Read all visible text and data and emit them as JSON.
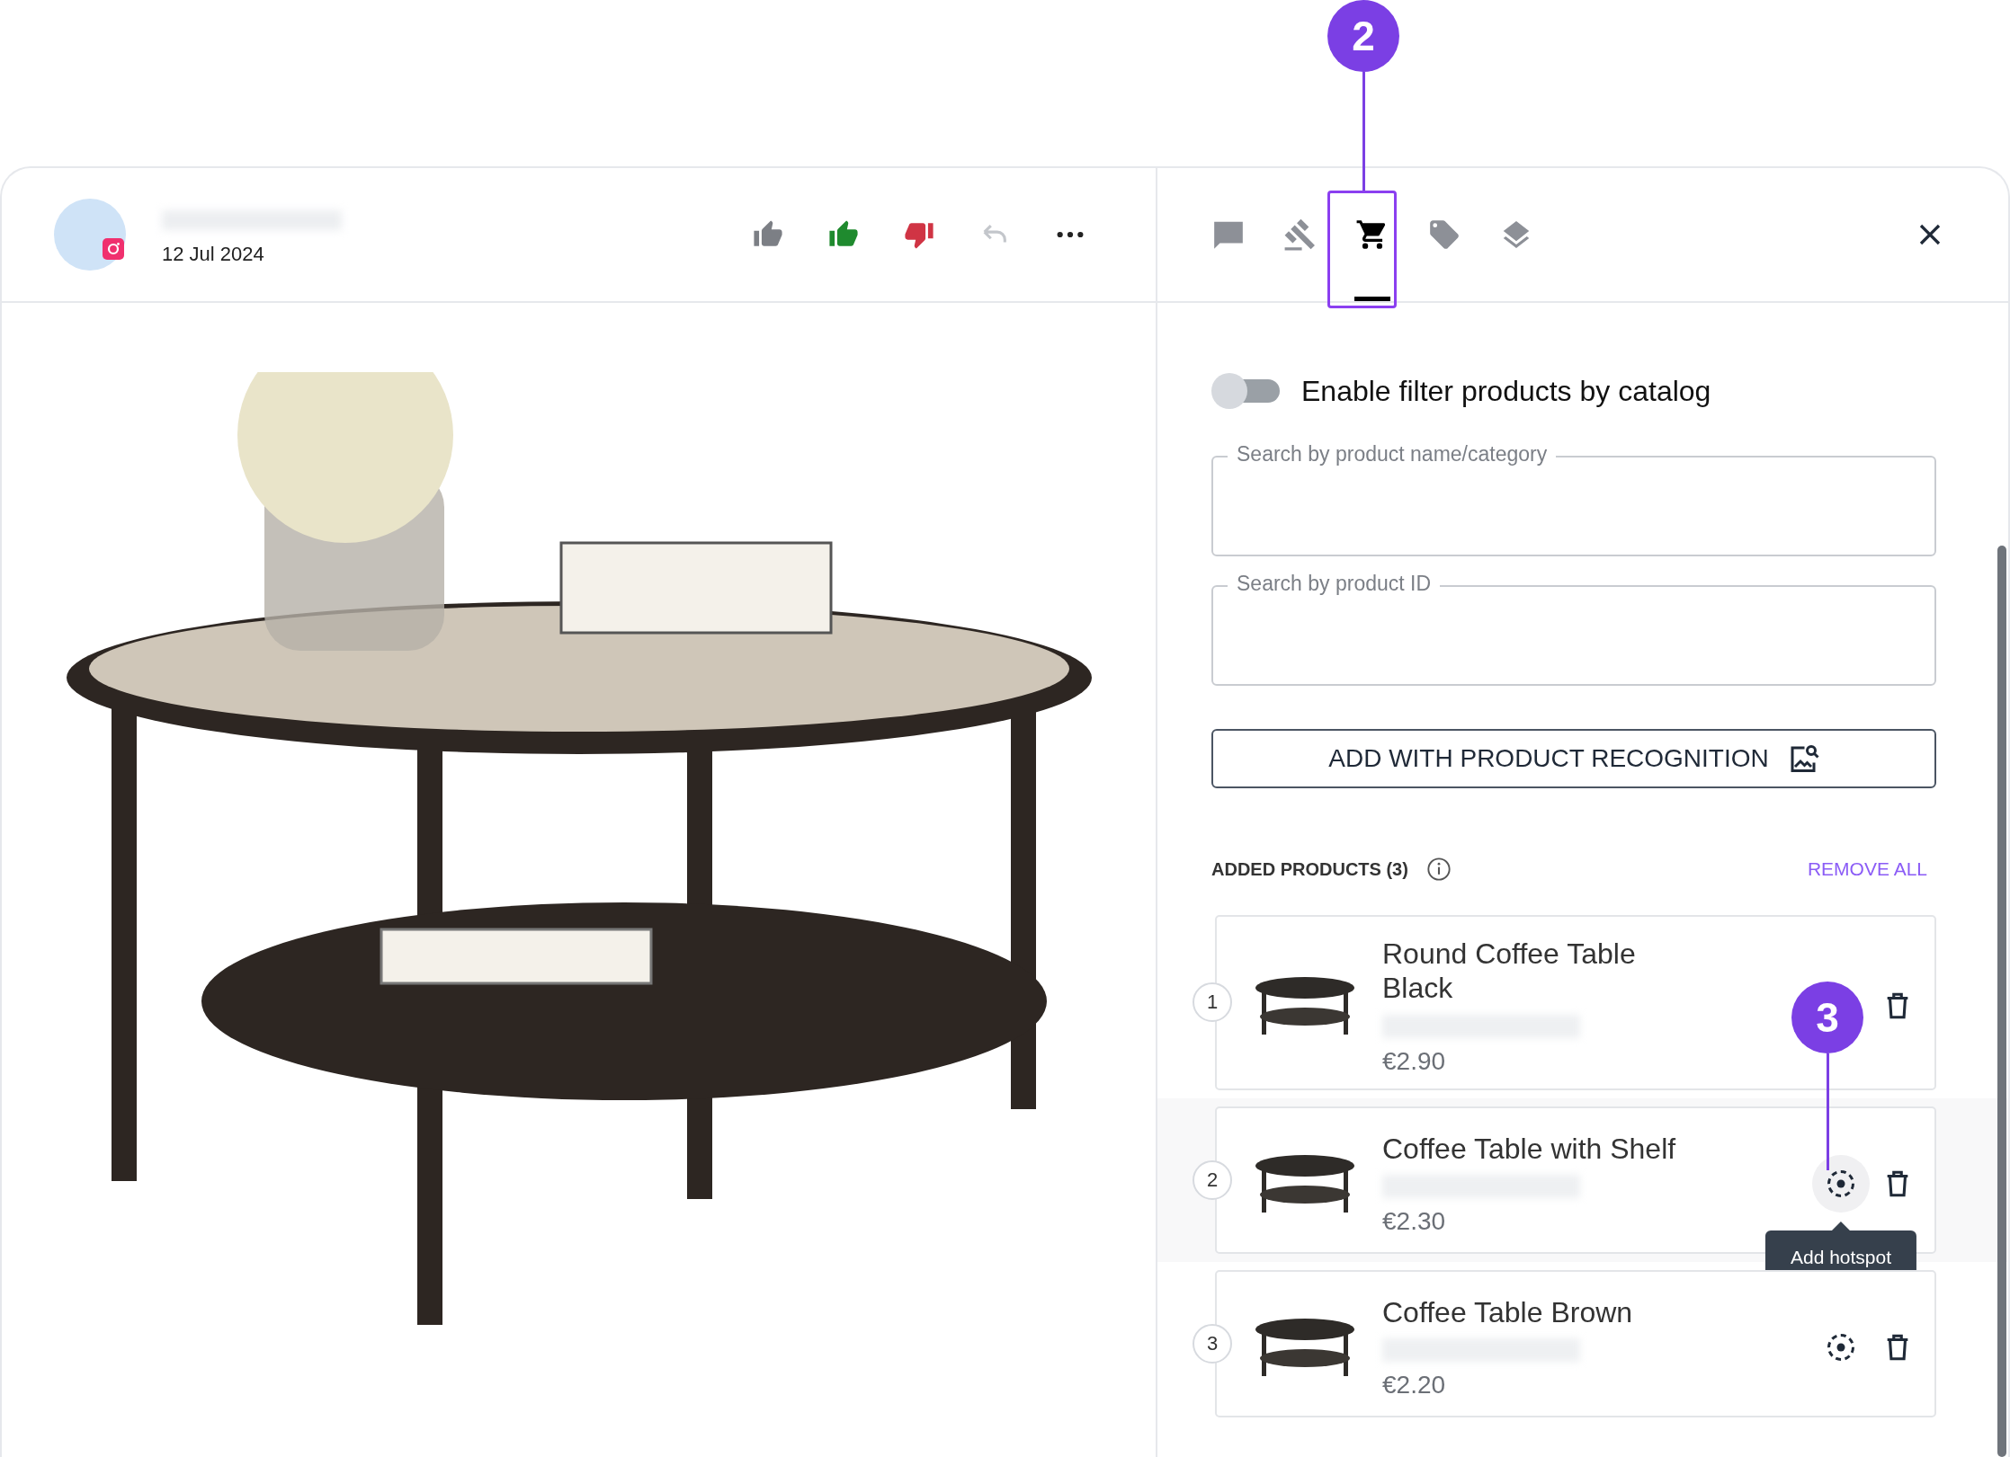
{
  "post": {
    "date": "12 Jul 2024"
  },
  "tabs": [
    {
      "kind": "comment",
      "selected": false
    },
    {
      "kind": "gavel",
      "selected": false
    },
    {
      "kind": "cart",
      "selected": true
    },
    {
      "kind": "tag",
      "selected": false
    },
    {
      "kind": "layers",
      "selected": false
    }
  ],
  "filter_toggle": {
    "label": "Enable filter products by catalog",
    "on": false
  },
  "search_fields": [
    {
      "label": "Search by product name/category"
    },
    {
      "label": "Search by product ID"
    }
  ],
  "recognition_button": "ADD WITH PRODUCT RECOGNITION",
  "added_products": {
    "heading": "ADDED PRODUCTS (3)",
    "remove_all": "REMOVE ALL",
    "items": [
      {
        "number": "1",
        "name": "Round Coffee Table Black",
        "price": "€2.90",
        "hovered": false
      },
      {
        "number": "2",
        "name": "Coffee Table with Shelf",
        "price": "€2.30",
        "hovered": true,
        "tooltip": "Add hotspot"
      },
      {
        "number": "3",
        "name": "Coffee Table Brown",
        "price": "€2.20",
        "hovered": false
      }
    ]
  },
  "callouts": [
    {
      "number": "2"
    },
    {
      "number": "3"
    }
  ]
}
